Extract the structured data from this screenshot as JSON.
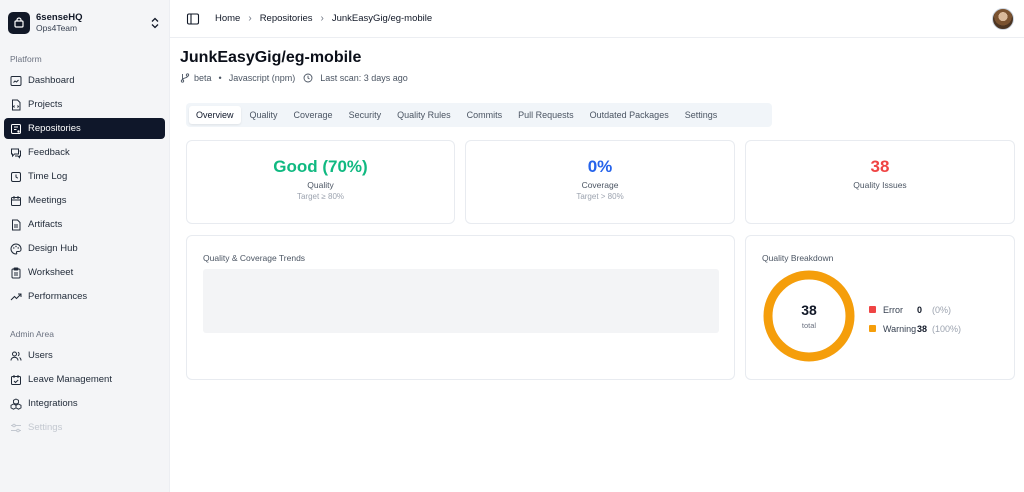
{
  "sidebar": {
    "org_name": "6senseHQ",
    "org_team": "Ops4Team",
    "platform_label": "Platform",
    "admin_label": "Admin Area",
    "platform_items": [
      {
        "label": "Dashboard",
        "icon": "dashboard-icon"
      },
      {
        "label": "Projects",
        "icon": "projects-icon"
      },
      {
        "label": "Repositories",
        "icon": "repositories-icon",
        "active": true
      },
      {
        "label": "Feedback",
        "icon": "feedback-icon"
      },
      {
        "label": "Time Log",
        "icon": "clock-icon"
      },
      {
        "label": "Meetings",
        "icon": "calendar-icon"
      },
      {
        "label": "Artifacts",
        "icon": "document-icon"
      },
      {
        "label": "Design Hub",
        "icon": "palette-icon"
      },
      {
        "label": "Worksheet",
        "icon": "clipboard-icon"
      },
      {
        "label": "Performances",
        "icon": "trend-up-icon"
      }
    ],
    "admin_items": [
      {
        "label": "Users",
        "icon": "users-icon"
      },
      {
        "label": "Leave Management",
        "icon": "calendar-check-icon"
      },
      {
        "label": "Integrations",
        "icon": "blocks-icon"
      },
      {
        "label": "Settings",
        "icon": "sliders-icon",
        "disabled": true
      }
    ]
  },
  "header": {
    "breadcrumbs": [
      "Home",
      "Repositories",
      "JunkEasyGig/eg-mobile"
    ]
  },
  "repo": {
    "title": "JunkEasyGig/eg-mobile",
    "branch": "beta",
    "language": "Javascript (npm)",
    "last_scan": "Last scan: 3 days ago"
  },
  "tabs": [
    "Overview",
    "Quality",
    "Coverage",
    "Security",
    "Quality Rules",
    "Commits",
    "Pull Requests",
    "Outdated Packages",
    "Settings"
  ],
  "active_tab": "Overview",
  "stats": {
    "quality": {
      "value": "Good (70%)",
      "label": "Quality",
      "sub": "Target ≥ 80%",
      "color": "#10b981"
    },
    "coverage": {
      "value": "0%",
      "label": "Coverage",
      "sub": "Target > 80%",
      "color": "#2563eb"
    },
    "issues": {
      "value": "38",
      "label": "Quality Issues",
      "color": "#ef4444"
    }
  },
  "trends": {
    "title": "Quality & Coverage Trends"
  },
  "breakdown": {
    "title": "Quality Breakdown",
    "total": "38",
    "total_label": "total",
    "items": [
      {
        "name": "Error",
        "count": "0",
        "pct": "(0%)",
        "color": "#ef4444",
        "fraction": 0
      },
      {
        "name": "Warning",
        "count": "38",
        "pct": "(100%)",
        "color": "#f59e0b",
        "fraction": 1
      }
    ]
  },
  "colors": {
    "accent": "#0f172a"
  }
}
